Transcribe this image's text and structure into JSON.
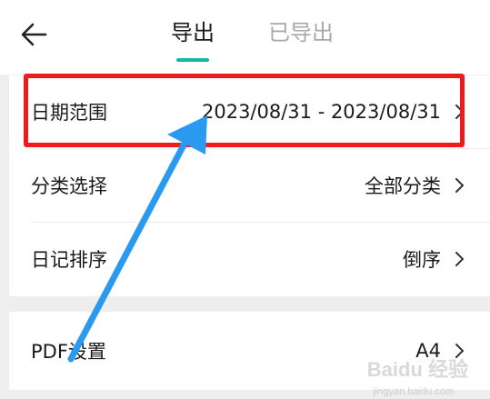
{
  "header": {
    "back_icon": "arrow-left-icon",
    "tabs": [
      {
        "label": "导出",
        "active": true
      },
      {
        "label": "已导出",
        "active": false
      }
    ],
    "accent_color": "#1bb5a6"
  },
  "settings": {
    "rows": [
      {
        "label": "日期范围",
        "value": "2023/08/31 - 2023/08/31"
      },
      {
        "label": "分类选择",
        "value": "全部分类"
      },
      {
        "label": "日记排序",
        "value": "倒序"
      }
    ],
    "pdf_row": {
      "label": "PDF设置",
      "value": "A4"
    },
    "chevron_icon": "chevron-right-icon"
  },
  "annotation": {
    "highlight_color": "#ee1b1b",
    "arrow_color": "#2a9af0"
  },
  "watermark": {
    "text": "Baidu 经验",
    "sub": "jingyan.baidu.com"
  }
}
